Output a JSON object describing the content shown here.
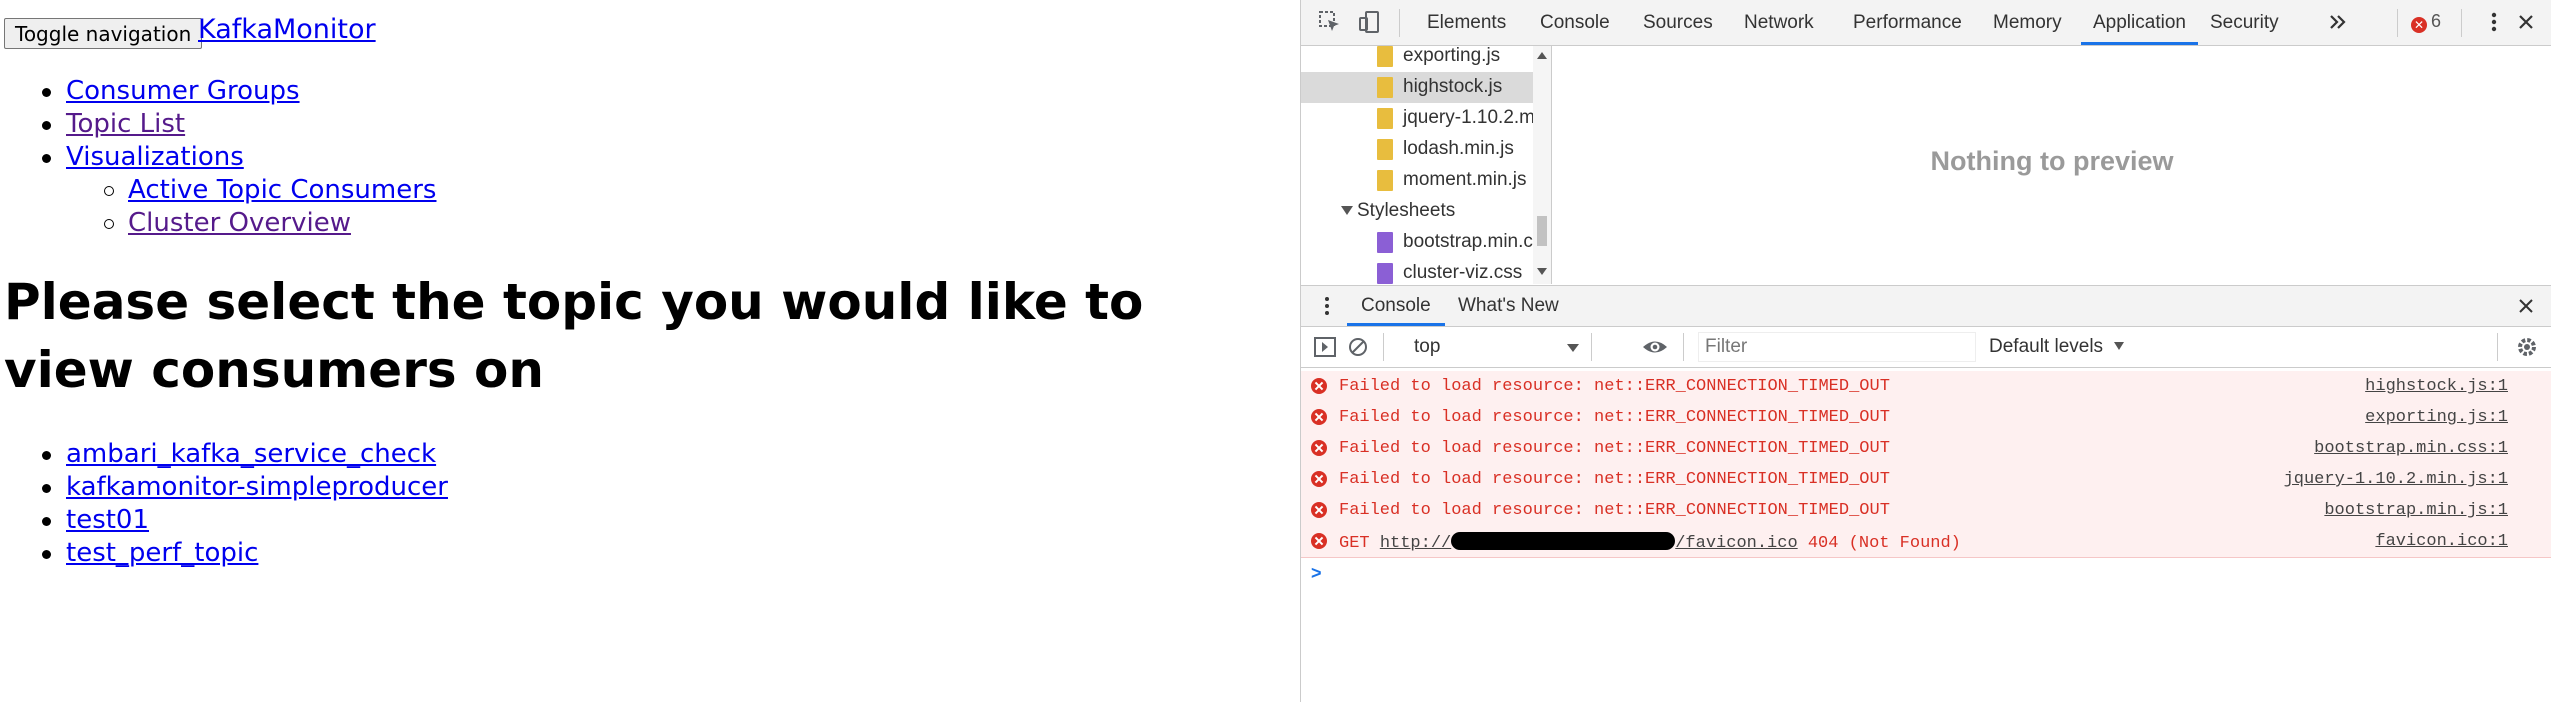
{
  "page": {
    "toggle_button": "Toggle navigation",
    "brand": "KafkaMonitor",
    "nav": [
      {
        "label": "Consumer Groups"
      },
      {
        "label": "Topic List"
      },
      {
        "label": "Visualizations"
      }
    ],
    "subnav": [
      {
        "label": "Active Topic Consumers"
      },
      {
        "label": "Cluster Overview"
      }
    ],
    "heading": "Please select the topic you would like to view consumers on",
    "topics": [
      {
        "label": "ambari_kafka_service_check"
      },
      {
        "label": "kafkamonitor-simpleproducer"
      },
      {
        "label": "test01"
      },
      {
        "label": "test_perf_topic"
      }
    ]
  },
  "devtools": {
    "tabs": [
      "Elements",
      "Console",
      "Sources",
      "Network",
      "Performance",
      "Memory",
      "Application",
      "Security"
    ],
    "active_tab": "Application",
    "more_tabs_icon": "chevron-double-right",
    "error_count": "6",
    "tree": {
      "files_js": [
        "exporting.js",
        "highstock.js",
        "jquery-1.10.2.m",
        "lodash.min.js",
        "moment.min.js"
      ],
      "folder": "Stylesheets",
      "files_css": [
        "bootstrap.min.c",
        "cluster-viz.css"
      ],
      "selected": "highstock.js"
    },
    "preview_text": "Nothing to preview",
    "drawer_tabs": [
      "Console",
      "What's New"
    ],
    "console": {
      "context": "top",
      "filter_placeholder": "Filter",
      "levels": "Default levels",
      "messages": [
        {
          "text": "Failed to load resource: net::ERR_CONNECTION_TIMED_OUT",
          "source": "highstock.js:1"
        },
        {
          "text": "Failed to load resource: net::ERR_CONNECTION_TIMED_OUT",
          "source": "exporting.js:1"
        },
        {
          "text": "Failed to load resource: net::ERR_CONNECTION_TIMED_OUT",
          "source": "bootstrap.min.css:1"
        },
        {
          "text": "Failed to load resource: net::ERR_CONNECTION_TIMED_OUT",
          "source": "jquery-1.10.2.min.js:1"
        },
        {
          "text": "Failed to load resource: net::ERR_CONNECTION_TIMED_OUT",
          "source": "bootstrap.min.js:1"
        }
      ],
      "get_message": {
        "prefix": "GET ",
        "url_start": "http://",
        "url_end": "/favicon.ico",
        "suffix": " 404 (Not Found)",
        "source": "favicon.ico:1"
      },
      "prompt": ">"
    },
    "colors": {
      "error": "#d93025",
      "accent": "#1a73e8",
      "js_file": "#e8bd3e",
      "css_file": "#8b5fd5"
    }
  }
}
